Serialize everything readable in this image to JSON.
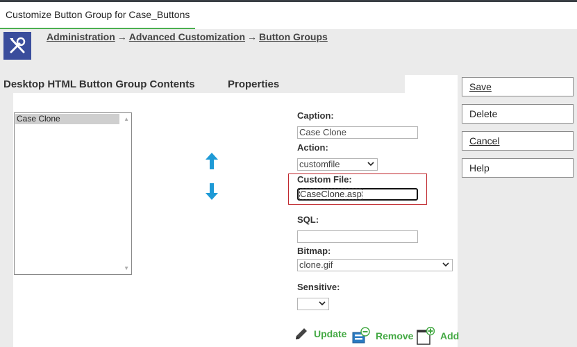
{
  "window": {
    "title": "Customize Button Group for Case_Buttons"
  },
  "breadcrumb": {
    "items": [
      "Administration",
      "Advanced Customization",
      "Button Groups"
    ],
    "separator": "→"
  },
  "sections": {
    "contents_title": "Desktop HTML Button Group Contents",
    "properties_title": "Properties"
  },
  "list": {
    "items": [
      "Case Clone"
    ],
    "selected": "Case Clone"
  },
  "form": {
    "caption_label": "Caption:",
    "caption_value": "Case Clone",
    "action_label": "Action:",
    "action_value": "customfile",
    "custom_file_label": "Custom File:",
    "custom_file_value": "CaseClone.asp",
    "sql_label": "SQL:",
    "sql_value": "",
    "bitmap_label": "Bitmap:",
    "bitmap_value": "clone.gif",
    "sensitive_label": "Sensitive:",
    "sensitive_value": ""
  },
  "actions": {
    "update": "Update",
    "remove": "Remove",
    "add": "Add"
  },
  "side_buttons": {
    "save": "Save",
    "delete": "Delete",
    "cancel": "Cancel",
    "help": "Help"
  },
  "icons": {
    "move_up": "arrow-up-icon",
    "move_down": "arrow-down-icon",
    "update": "pencil-icon",
    "remove": "remove-icon",
    "add": "add-icon",
    "app": "tools-icon"
  },
  "colors": {
    "accent_green": "#44a944",
    "arrow_blue": "#1e9ad6",
    "icon_bg": "#3a4d9c",
    "highlight": "#c0282e"
  }
}
